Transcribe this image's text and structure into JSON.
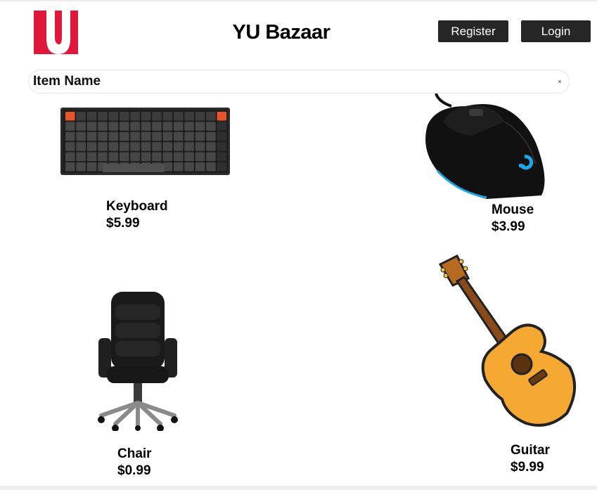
{
  "header": {
    "title": "YU Bazaar",
    "register_label": "Register",
    "login_label": "Login",
    "logo_icon": "yu-logo-icon",
    "brand_color": "#e0173a"
  },
  "search": {
    "placeholder": "Item Name",
    "value": "",
    "clear_glyph": "×"
  },
  "items": [
    {
      "name": "Keyboard",
      "price": "$5.99",
      "icon": "keyboard-image"
    },
    {
      "name": "Mouse",
      "price": "$3.99",
      "icon": "mouse-image"
    },
    {
      "name": "Chair",
      "price": "$0.99",
      "icon": "chair-image"
    },
    {
      "name": "Guitar",
      "price": "$9.99",
      "icon": "guitar-image"
    }
  ]
}
